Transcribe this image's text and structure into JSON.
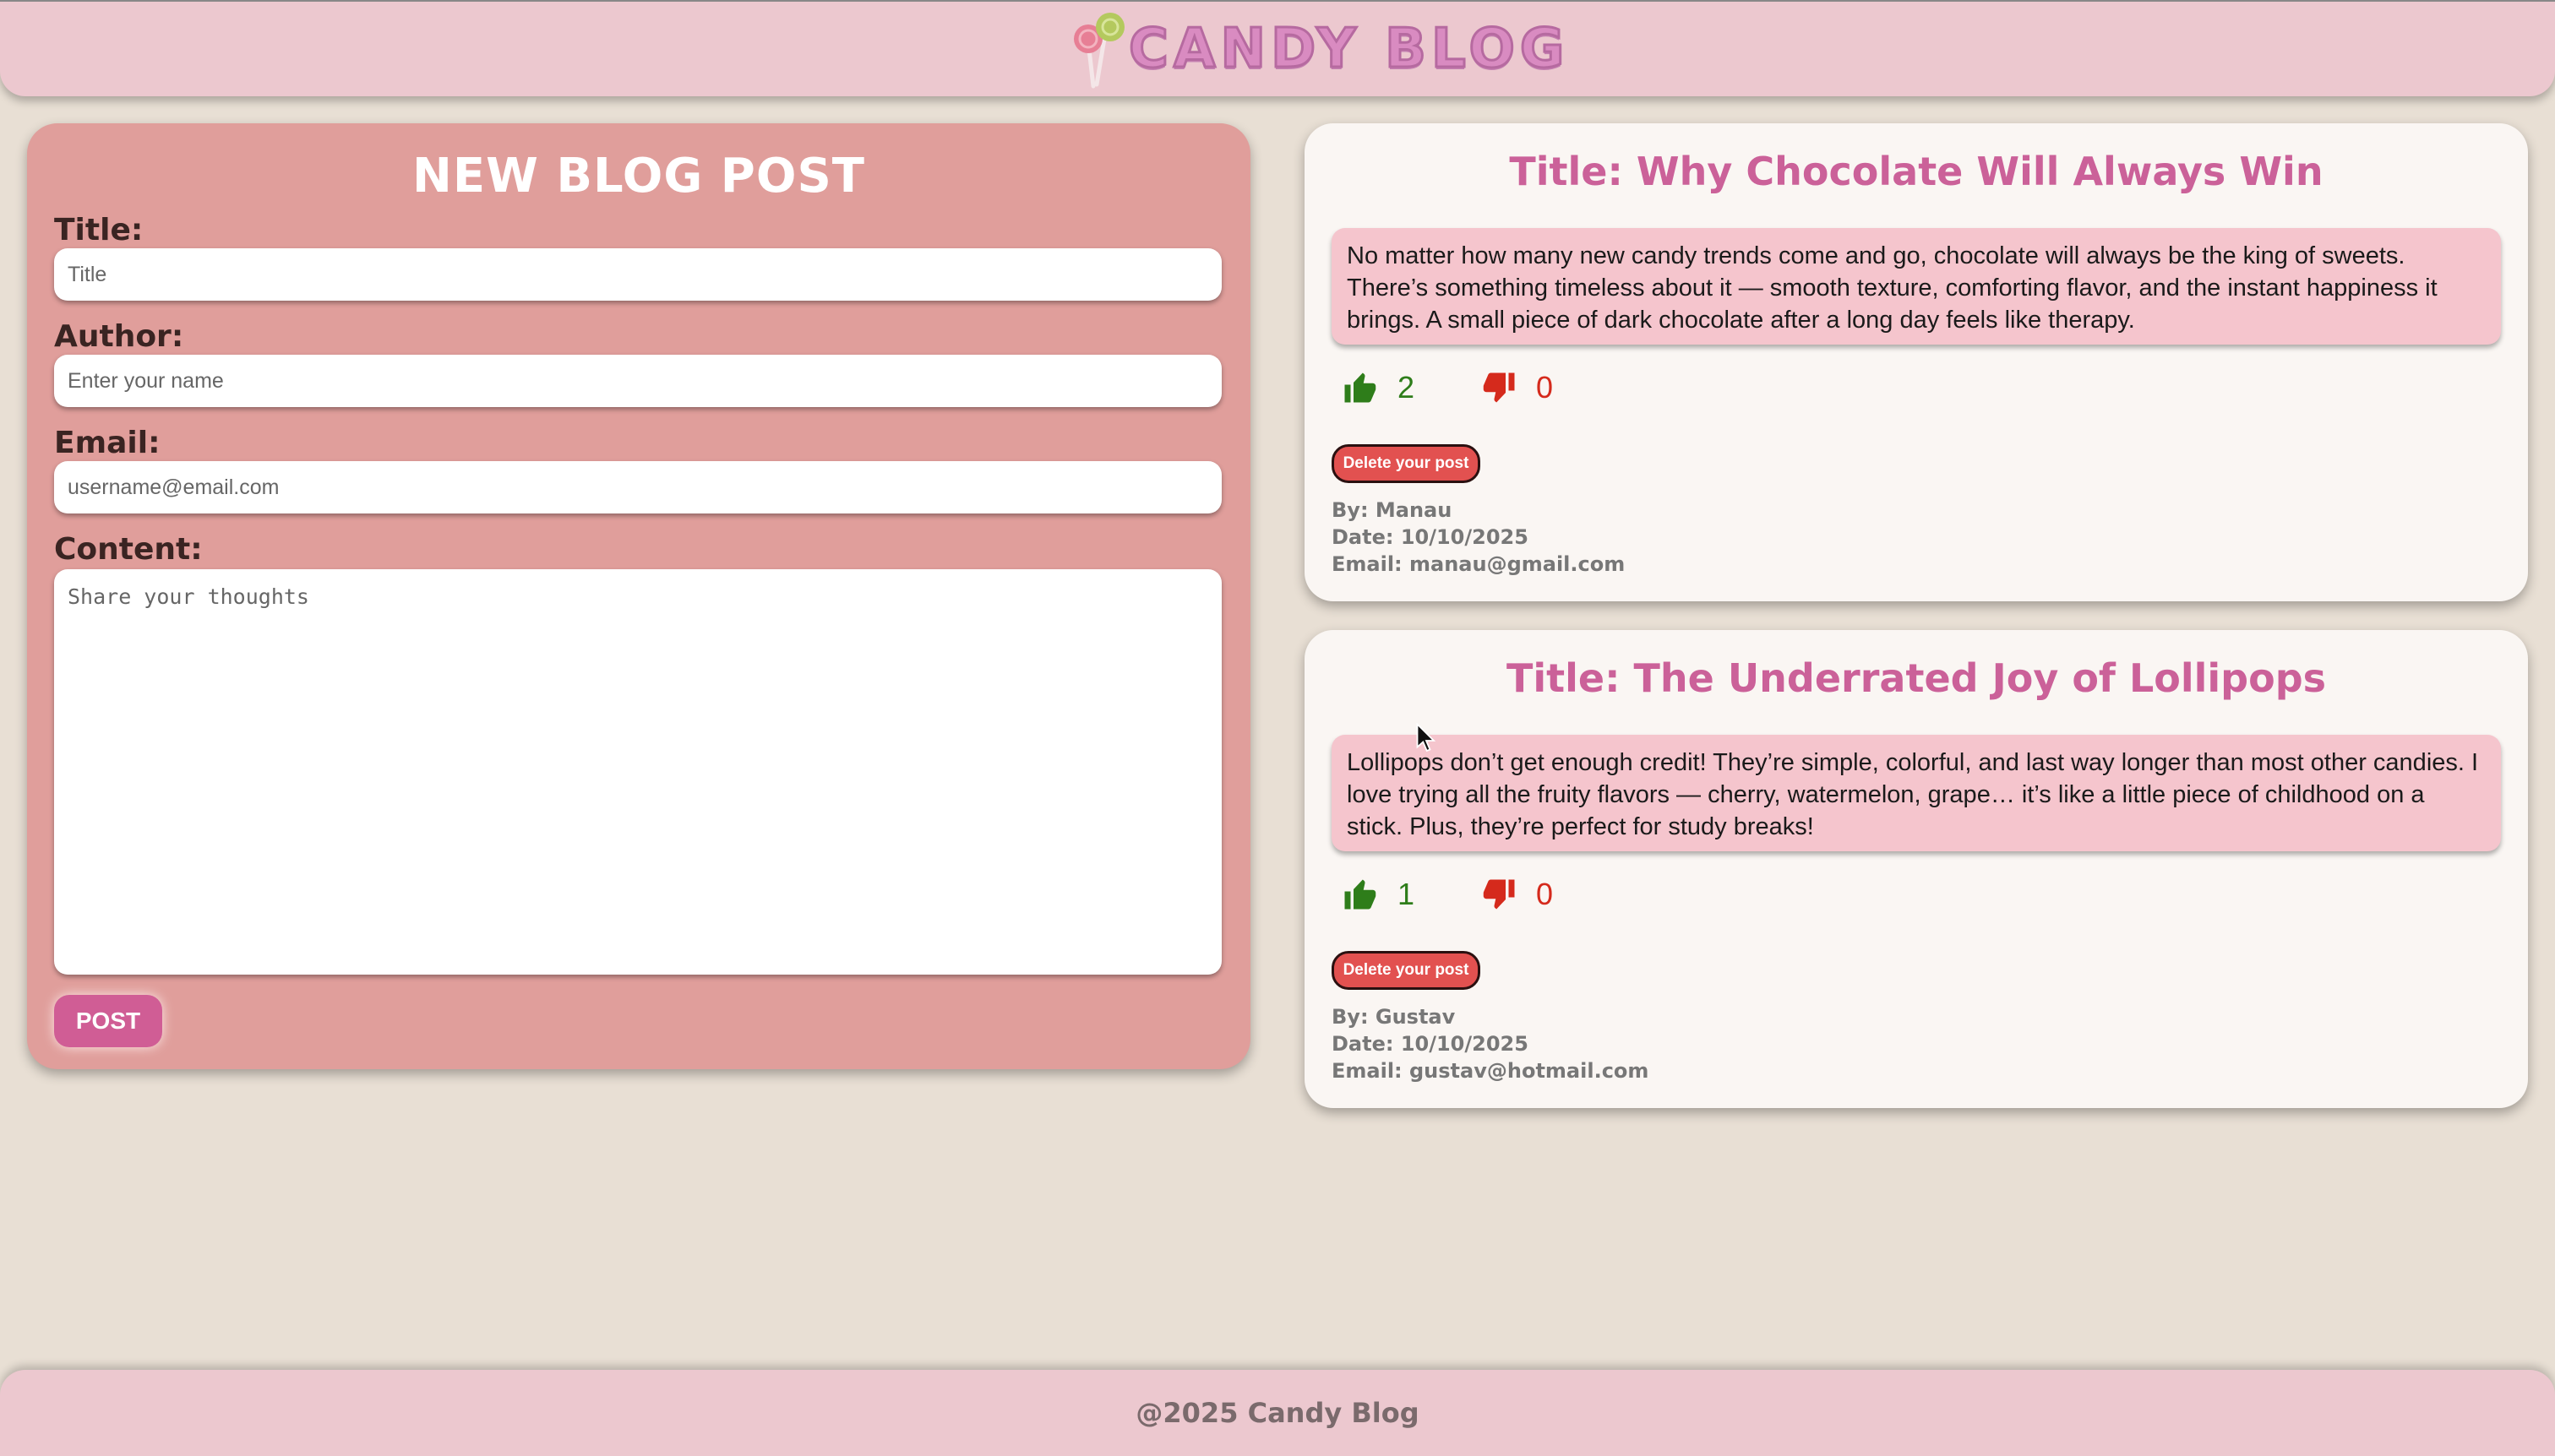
{
  "header": {
    "logo_text": "CANDY BLOG",
    "logo_icon": "lollipop-icon"
  },
  "form": {
    "heading": "NEW BLOG POST",
    "title_label": "Title:",
    "title_placeholder": "Title",
    "author_label": "Author:",
    "author_placeholder": "Enter your name",
    "email_label": "Email:",
    "email_placeholder": "username@email.com",
    "content_label": "Content:",
    "content_placeholder": "Share your thoughts",
    "post_button": "POST"
  },
  "posts": [
    {
      "title": "Title: Why Chocolate Will Always Win",
      "content": "No matter how many new candy trends come and go, chocolate will always be the king of sweets. There’s something timeless about it — smooth texture, comforting flavor, and the instant happiness it brings. A small piece of dark chocolate after a long day feels like therapy.",
      "likes": "2",
      "dislikes": "0",
      "delete_label": "Delete your post",
      "by": "By: Manau",
      "date": "Date: 10/10/2025",
      "email": "Email: manau@gmail.com"
    },
    {
      "title": "Title: The Underrated Joy of Lollipops",
      "content": "Lollipops don’t get enough credit! They’re simple, colorful, and last way longer than most other candies. I love trying all the fruity flavors — cherry, watermelon, grape… it’s like a little piece of childhood on a stick. Plus, they’re perfect for study breaks!",
      "likes": "1",
      "dislikes": "0",
      "delete_label": "Delete your post",
      "by": "By: Gustav",
      "date": "Date: 10/10/2025",
      "email": "Email: gustav@hotmail.com"
    }
  ],
  "footer": {
    "text": "@2025 Candy Blog"
  },
  "colors": {
    "background": "#e8dfd4",
    "header": "#ecc8cf",
    "form_panel": "#e09e9b",
    "accent_pink": "#cb6199",
    "like_green": "#2e7d1a",
    "dislike_red": "#d52a1c",
    "delete_red": "#e25150"
  },
  "icons": {
    "like": "thumbs-up-icon",
    "dislike": "thumbs-down-icon",
    "cursor": "mouse-pointer-icon"
  }
}
